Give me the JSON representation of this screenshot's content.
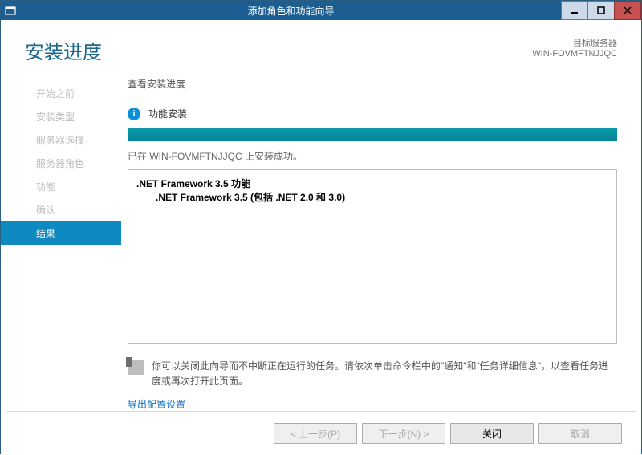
{
  "window": {
    "title": "添加角色和功能向导"
  },
  "header": {
    "heading": "安装进度",
    "target_label": "目标服务器",
    "target_value": "WIN-FOVMFTNJJQC"
  },
  "sidebar": {
    "items": [
      {
        "label": "开始之前"
      },
      {
        "label": "安装类型"
      },
      {
        "label": "服务器选择"
      },
      {
        "label": "服务器角色"
      },
      {
        "label": "功能"
      },
      {
        "label": "确认"
      },
      {
        "label": "结果"
      }
    ]
  },
  "main": {
    "subheading": "查看安装进度",
    "status_text": "功能安装",
    "done_message": "已在 WIN-FOVMFTNJJQC 上安装成功。",
    "result_line1": ".NET Framework 3.5 功能",
    "result_line2": ".NET Framework 3.5 (包括 .NET 2.0 和 3.0)",
    "note_text": "你可以关闭此向导而不中断正在运行的任务。请依次单击命令栏中的\"通知\"和\"任务详细信息\"，以查看任务进度或再次打开此页面。",
    "export_link": "导出配置设置"
  },
  "footer": {
    "prev": "< 上一步(P)",
    "next": "下一步(N) >",
    "close": "关闭",
    "cancel": "取消"
  }
}
